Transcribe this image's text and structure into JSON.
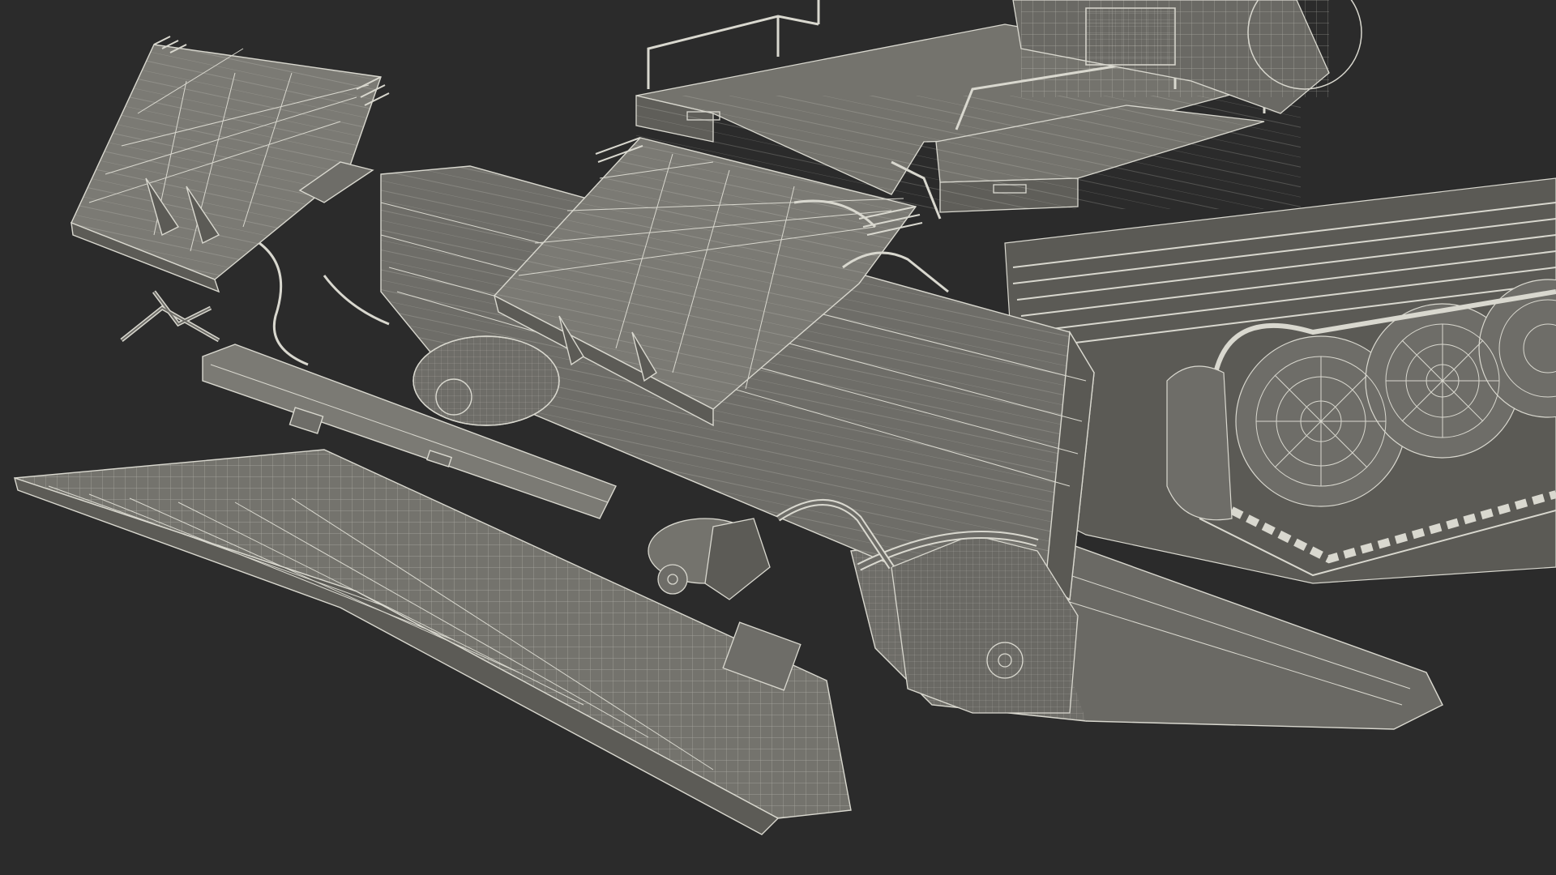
{
  "scene": {
    "background": "#2b2b2b",
    "mesh_fill": "#6e6d68",
    "mesh_fill_light": "#7b7a74",
    "mesh_fill_dark": "#55544f",
    "wire_color": "#d9d8cf",
    "wire_dim": "#a9a89f"
  }
}
